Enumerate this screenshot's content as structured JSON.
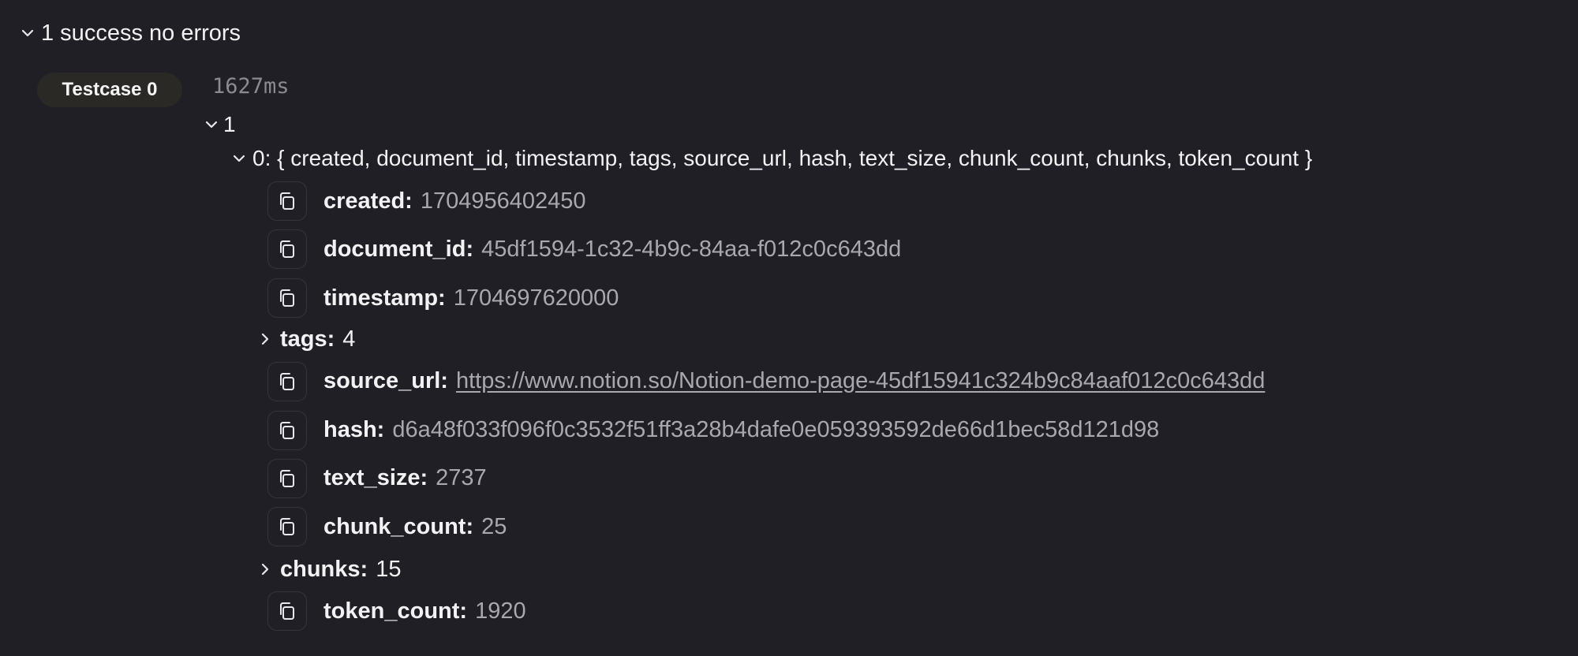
{
  "summary": {
    "label": "1 success no errors"
  },
  "testcase": {
    "badge_label": "Testcase 0",
    "duration": "1627ms"
  },
  "tree": {
    "root_label": "1",
    "object_label": "0: { created, document_id, timestamp, tags, source_url, hash, text_size, chunk_count, chunks, token_count }",
    "fields": [
      {
        "key": "created:",
        "value": "1704956402450"
      },
      {
        "key": "document_id:",
        "value": "45df1594-1c32-4b9c-84aa-f012c0c643dd"
      },
      {
        "key": "timestamp:",
        "value": "1704697620000"
      },
      {
        "key": "source_url:",
        "value": "https://www.notion.so/Notion-demo-page-45df15941c324b9c84aaf012c0c643dd"
      },
      {
        "key": "hash:",
        "value": "d6a48f033f096f0c3532f51ff3a28b4dafe0e059393592de66d1bec58d121d98"
      },
      {
        "key": "text_size:",
        "value": "2737"
      },
      {
        "key": "chunk_count:",
        "value": "25"
      },
      {
        "key": "token_count:",
        "value": "1920"
      }
    ],
    "collapsed": [
      {
        "key": "tags:",
        "count": "4"
      },
      {
        "key": "chunks:",
        "count": "15"
      }
    ]
  },
  "colors": {
    "background": "#1f1f25",
    "text": "#f2f2f4",
    "value_text": "#a8a8ae",
    "muted_mono": "#8a8a92",
    "badge_bg": "#2b2926",
    "copy_border": "#34343c"
  },
  "icons": {
    "expand": "chevron-down-icon",
    "collapse": "chevron-right-icon",
    "copy": "copy-icon"
  }
}
